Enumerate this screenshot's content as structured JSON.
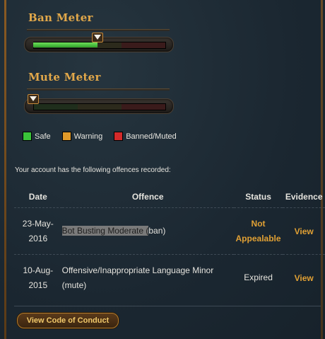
{
  "ban_meter": {
    "title": "Ban Meter",
    "level_fraction": 0.49
  },
  "mute_meter": {
    "title": "Mute Meter",
    "level_fraction": 0.0
  },
  "legend": [
    {
      "label": "Safe",
      "color": "#3ac43a"
    },
    {
      "label": "Warning",
      "color": "#e09a2a"
    },
    {
      "label": "Banned/Muted",
      "color": "#d42a2a"
    }
  ],
  "intro": "Your account has the following offences recorded:",
  "table": {
    "headers": {
      "date": "Date",
      "offence": "Offence",
      "status": "Status",
      "evidence": "Evidence"
    },
    "rows": [
      {
        "date_line1": "23-May-",
        "date_line2": "2016",
        "offence_highlight": "Bot Busting Moderate (",
        "offence_rest": "ban)",
        "status_line1": "Not",
        "status_line2": "Appealable",
        "evidence": "View"
      },
      {
        "date_line1": "10-Aug-",
        "date_line2": "2015",
        "offence_line1": "Offensive/Inappropriate Language Minor",
        "offence_line2": "(mute)",
        "status": "Expired",
        "evidence": "View"
      }
    ]
  },
  "code_of_conduct_button": "View Code of Conduct",
  "colors": {
    "accent": "#e0a034",
    "title": "#e2a84a"
  }
}
